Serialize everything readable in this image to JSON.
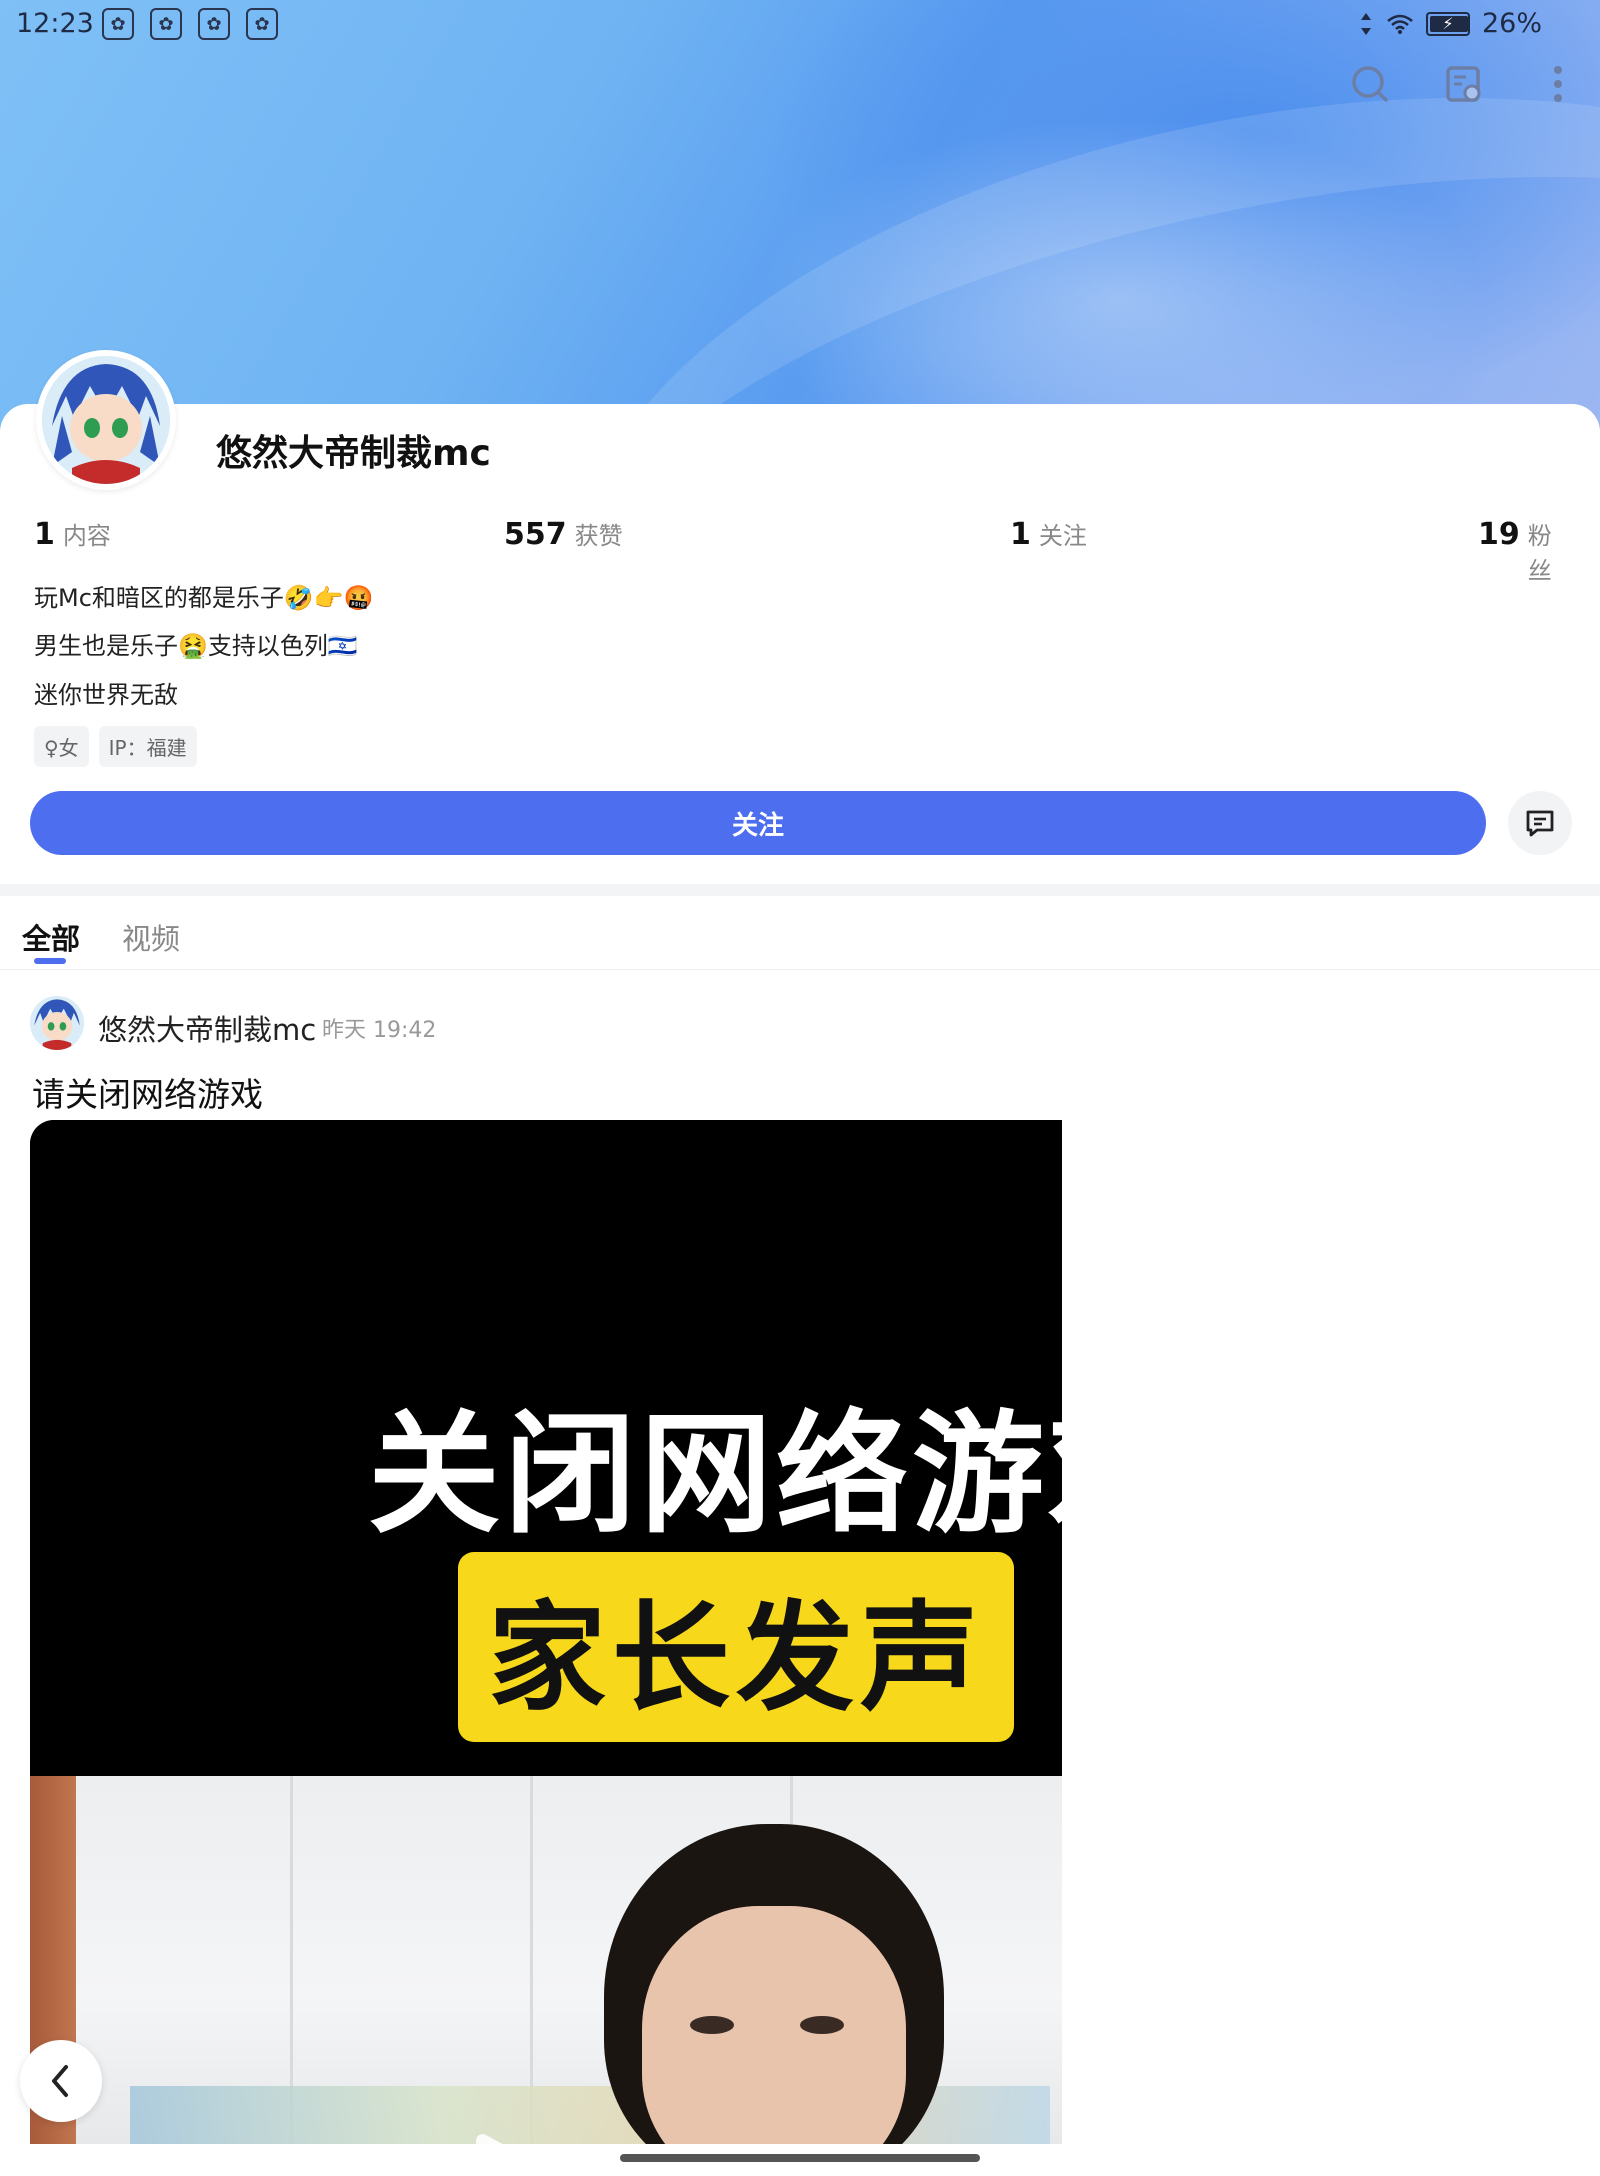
{
  "status_bar": {
    "time": "12:23",
    "battery": "26%",
    "battery_level": 0.26
  },
  "header": {
    "actions": [
      "search-icon",
      "reader-mode-icon",
      "more-icon"
    ]
  },
  "profile": {
    "username": "悠然大帝制裁mc",
    "stats": [
      {
        "value": "1",
        "label": "内容"
      },
      {
        "value": "557",
        "label": "获赞"
      },
      {
        "value": "1",
        "label": "关注"
      },
      {
        "value": "19",
        "label": "粉丝"
      }
    ],
    "bio": [
      "玩Mc和暗区的都是乐子🤣👉🤬",
      "男生也是乐子🤮支持以色列🇮🇱",
      "迷你世界无敌"
    ],
    "tags": [
      "♀女",
      "IP：福建"
    ],
    "follow_label": "关注"
  },
  "tabs": [
    {
      "label": "全部",
      "active": true
    },
    {
      "label": "视频",
      "active": false
    }
  ],
  "post": {
    "author": "悠然大帝制裁mc",
    "time": "昨天 19:42",
    "title": "请关闭网络游戏",
    "video_headline": "关闭网络游戏",
    "video_badge": "家长发声"
  },
  "colors": {
    "accent": "#4e6ef0",
    "badge_yellow": "#f7d81b"
  }
}
